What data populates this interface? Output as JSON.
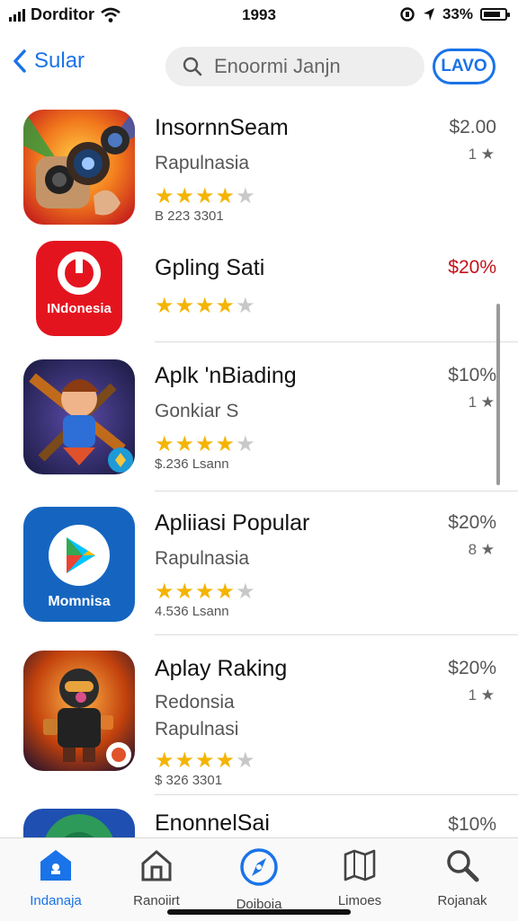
{
  "status_bar": {
    "carrier": "Dorditor",
    "time": "1993",
    "battery": "33%"
  },
  "nav": {
    "back_label": "Sular",
    "search_placeholder": "Enoormi Janjn",
    "action_label": "LAVO"
  },
  "apps": [
    {
      "title": "InsornnSeam",
      "subtitle": "Rapulnasia",
      "price": "$2.00",
      "count": "1 ★",
      "rating": 4,
      "meta": "B 223 3301",
      "icon_text": ""
    },
    {
      "title": "Gpling Sati",
      "subtitle": "",
      "price": "$20%",
      "count": "",
      "rating": 4,
      "meta": "",
      "icon_text": "INdonesia"
    },
    {
      "title": "Aplk 'nBiading",
      "subtitle": "Gonkiar S",
      "price": "$10%",
      "count": "1 ★",
      "rating": 4,
      "meta": "$.236 Lsann",
      "icon_text": ""
    },
    {
      "title": "Apliiasi Popular",
      "subtitle": "Rapulnasia",
      "price": "$20%",
      "count": "8 ★",
      "rating": 4,
      "meta": "4.536 Lsann",
      "icon_text": "Momnisa"
    },
    {
      "title": "Aplay Raking",
      "subtitle": "Redonsia",
      "subtitle2": "Rapulnasi",
      "price": "$20%",
      "count": "1 ★",
      "rating": 4,
      "meta": "$ 326 3301",
      "icon_text": ""
    },
    {
      "title": "EnonnelSai",
      "subtitle": "",
      "price": "$10%",
      "count": "",
      "rating": 0,
      "meta": "",
      "icon_text": ""
    }
  ],
  "tabs": [
    {
      "label": "Indanaja",
      "icon": "home-icon"
    },
    {
      "label": "Ranoiirt",
      "icon": "house-outline-icon"
    },
    {
      "label": "Doiboia",
      "icon": "compass-icon"
    },
    {
      "label": "Limoes",
      "icon": "map-icon"
    },
    {
      "label": "Rojanak",
      "icon": "search-icon"
    }
  ],
  "colors": {
    "accent": "#1a73e8",
    "star": "#f4b400",
    "price_red": "#c4121b"
  }
}
